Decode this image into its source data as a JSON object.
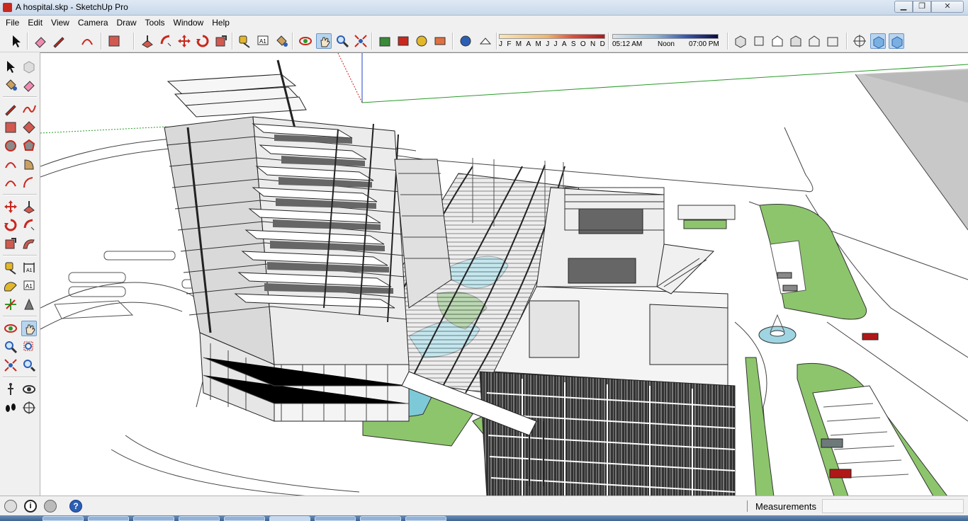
{
  "window": {
    "title": "A hospital.skp - SketchUp Pro",
    "app_icon": "sketchup-icon",
    "controls": {
      "minimize": "▁",
      "maximize": "❐",
      "close": "✕"
    }
  },
  "menu": [
    "File",
    "Edit",
    "View",
    "Camera",
    "Draw",
    "Tools",
    "Window",
    "Help"
  ],
  "shadow_settings": {
    "months": [
      "J",
      "F",
      "M",
      "A",
      "M",
      "J",
      "J",
      "A",
      "S",
      "O",
      "N",
      "D"
    ],
    "time_start": "05:12 AM",
    "time_mid": "Noon",
    "time_end": "07:00 PM"
  },
  "statusbar": {
    "measurements_label": "Measurements",
    "measurements_value": ""
  },
  "colors": {
    "axis_green": "#2a9a2a",
    "axis_red": "#c81e1e",
    "axis_blue": "#2040c8",
    "lawn": "#8dc56c",
    "water": "#7ec9d8",
    "active_tool": "#b8d4ee"
  },
  "tools": {
    "top": [
      "select-icon",
      "eraser-icon",
      "pencil-icon",
      "arc-icon",
      "rectangle-icon",
      "push-pull-icon",
      "follow-me-icon",
      "move-icon",
      "rotate-icon",
      "scale-icon",
      "tape-measure-icon",
      "text-icon",
      "paint-bucket-icon",
      "orbit-icon",
      "pan-icon",
      "zoom-icon",
      "zoom-extents-icon",
      "warehouse-icon",
      "components-icon",
      "extension-icon",
      "send-icon",
      "xray-icon",
      "back-edges-icon",
      "iso-view-icon",
      "top-view-icon",
      "front-view-icon",
      "right-view-icon",
      "back-view-icon",
      "left-view-icon",
      "section-plane-icon",
      "section-display-icon",
      "section-cut-icon"
    ],
    "left": [
      "select-icon",
      "component-icon",
      "paint-bucket-icon",
      "eraser-icon",
      "line-icon",
      "freehand-icon",
      "rectangle-icon",
      "rotated-rectangle-icon",
      "circle-icon",
      "polygon-icon",
      "arc-icon",
      "pie-icon",
      "arc3-icon",
      "arc2-icon",
      "move-icon",
      "push-pull-icon",
      "rotate-icon",
      "follow-me-icon",
      "scale-icon",
      "offset-icon",
      "tape-measure-icon",
      "dimension-icon",
      "protractor-icon",
      "text-icon",
      "axes-icon",
      "3d-text-icon",
      "orbit-icon",
      "pan-icon",
      "zoom-icon",
      "zoom-window-icon",
      "zoom-extents-icon",
      "previous-view-icon",
      "walk-icon",
      "look-around-icon",
      "footprints-icon",
      "position-camera-icon"
    ]
  }
}
